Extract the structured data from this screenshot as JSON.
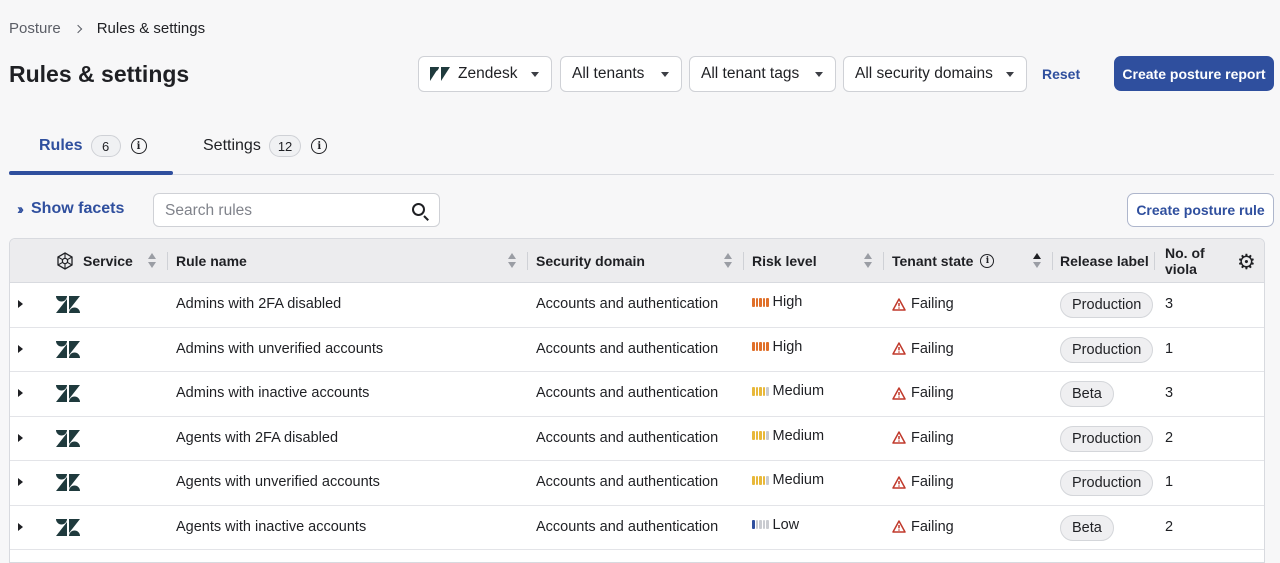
{
  "breadcrumb": {
    "parent": "Posture",
    "current": "Rules & settings"
  },
  "page_title": "Rules & settings",
  "filters": {
    "service": "Zendesk",
    "tenants": "All tenants",
    "tags": "All tenant tags",
    "domains": "All security domains"
  },
  "reset_label": "Reset",
  "create_report_label": "Create posture report",
  "tabs": [
    {
      "label": "Rules",
      "count": "6"
    },
    {
      "label": "Settings",
      "count": "12"
    }
  ],
  "show_facets_label": "Show facets",
  "search": {
    "placeholder": "Search rules",
    "value": ""
  },
  "create_rule_label": "Create posture rule",
  "table": {
    "columns": {
      "service": "Service",
      "rule_name": "Rule name",
      "security_domain": "Security domain",
      "risk_level": "Risk level",
      "tenant_state": "Tenant state",
      "release_label": "Release label",
      "violations": "No. of viola"
    },
    "rows": [
      {
        "rule": "Admins with 2FA disabled",
        "domain": "Accounts and authentication",
        "risk": "High",
        "state": "Failing",
        "release": "Production",
        "violations": "3"
      },
      {
        "rule": "Admins with unverified accounts",
        "domain": "Accounts and authentication",
        "risk": "High",
        "state": "Failing",
        "release": "Production",
        "violations": "1"
      },
      {
        "rule": "Admins with inactive accounts",
        "domain": "Accounts and authentication",
        "risk": "Medium",
        "state": "Failing",
        "release": "Beta",
        "violations": "3"
      },
      {
        "rule": "Agents with 2FA disabled",
        "domain": "Accounts and authentication",
        "risk": "Medium",
        "state": "Failing",
        "release": "Production",
        "violations": "2"
      },
      {
        "rule": "Agents with unverified accounts",
        "domain": "Accounts and authentication",
        "risk": "Medium",
        "state": "Failing",
        "release": "Production",
        "violations": "1"
      },
      {
        "rule": "Agents with inactive accounts",
        "domain": "Accounts and authentication",
        "risk": "Low",
        "state": "Failing",
        "release": "Beta",
        "violations": "2"
      }
    ]
  },
  "colors": {
    "accent": "#2f4f9e",
    "risk_high": "#e0702a",
    "risk_medium": "#e8b83a",
    "risk_low": "#2f4f9e",
    "risk_empty": "#c9cbd0",
    "failing": "#c0392b"
  }
}
